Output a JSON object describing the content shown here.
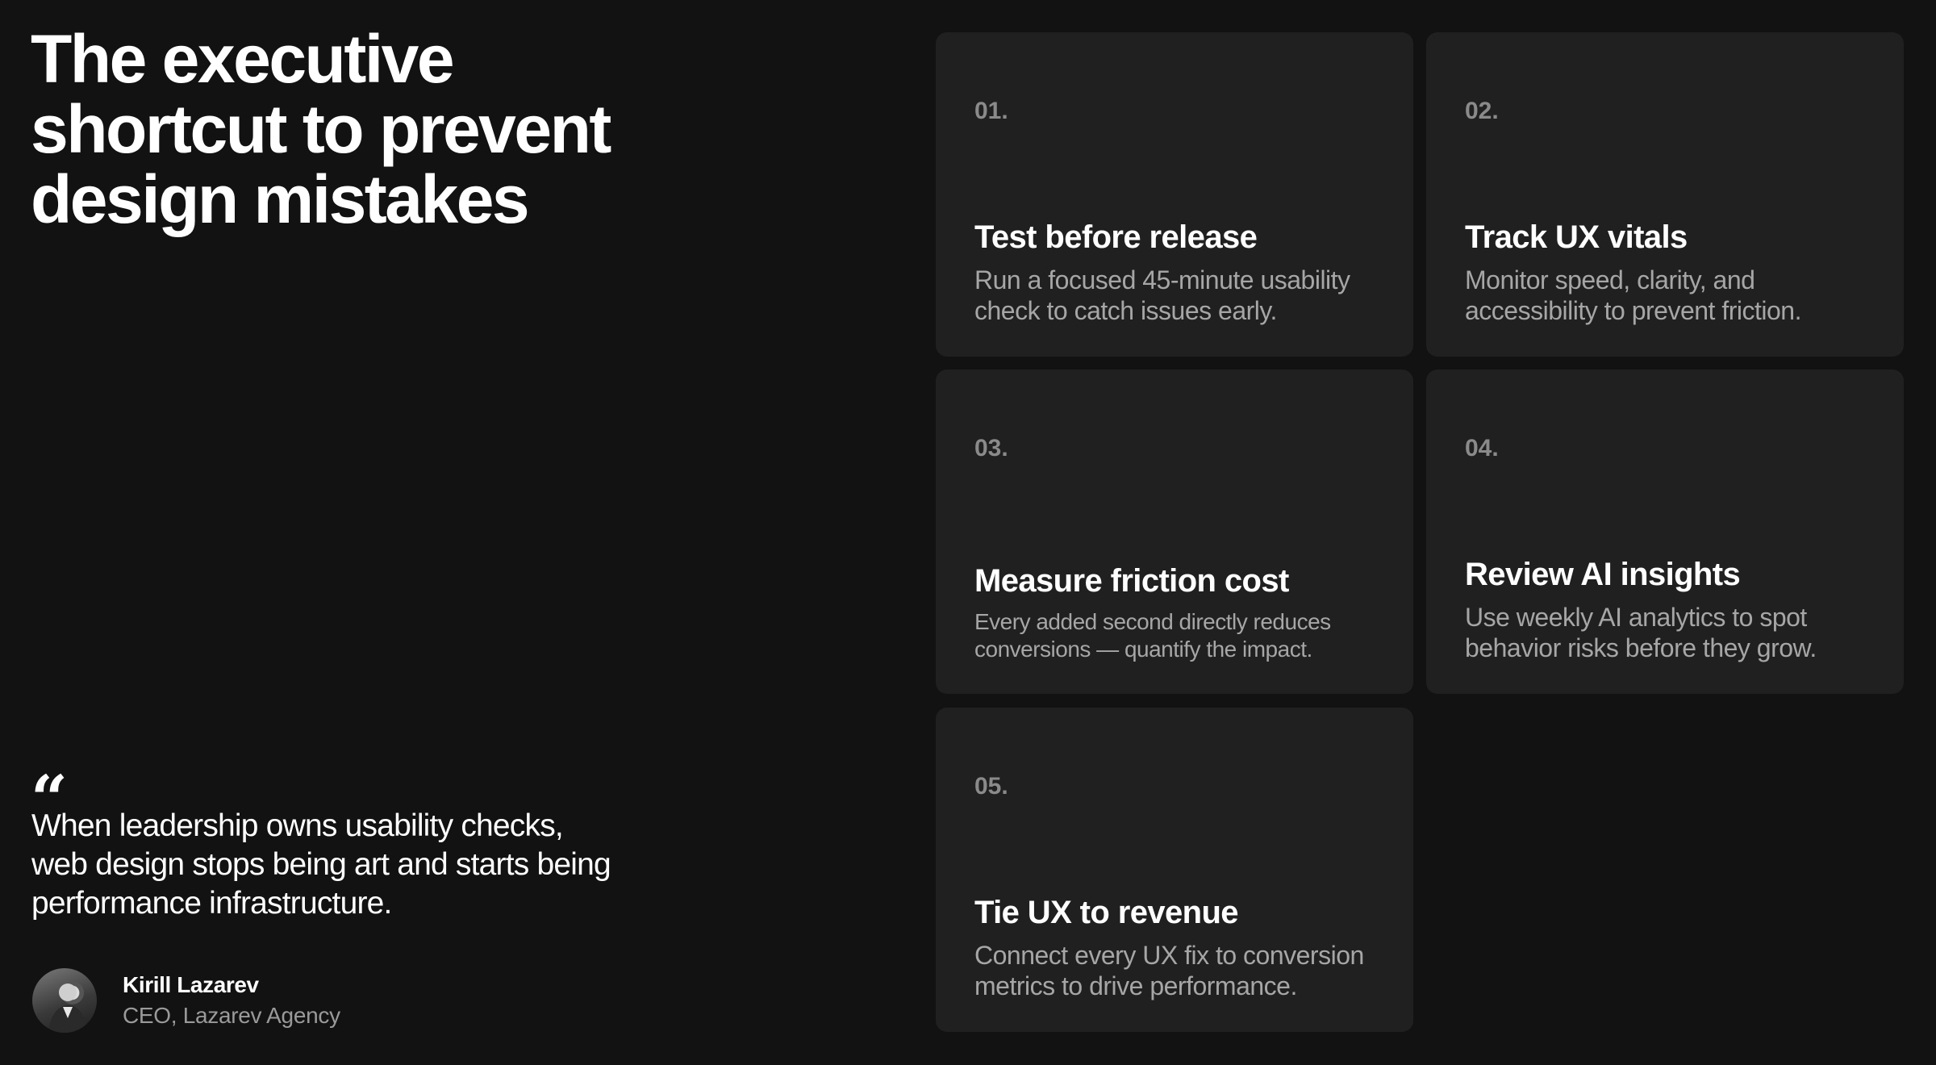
{
  "headline": "The executive shortcut to prevent design mistakes",
  "quote": {
    "mark": "“",
    "text": "When leadership owns usability checks, web design stops being art and starts being performance infrastructure."
  },
  "author": {
    "name": "Kirill Lazarev",
    "role": "CEO, Lazarev Agency"
  },
  "cards": [
    {
      "number": "01.",
      "title": "Test before release",
      "description": "Run a focused 45-minute usability check to catch issues early."
    },
    {
      "number": "02.",
      "title": "Track UX vitals",
      "description": "Monitor speed, clarity, and accessibility to prevent friction."
    },
    {
      "number": "03.",
      "title": "Measure friction cost",
      "description": "Every added second directly reduces conversions — quantify the impact."
    },
    {
      "number": "04.",
      "title": "Review AI insights",
      "description": "Use weekly AI analytics to spot behavior risks before they grow."
    },
    {
      "number": "05.",
      "title": "Tie UX to revenue",
      "description": "Connect every UX fix to conversion metrics to drive performance."
    }
  ],
  "colors": {
    "background": "#121212",
    "card": "#202020",
    "text": "#ffffff",
    "muted": "#a6a6a6"
  }
}
